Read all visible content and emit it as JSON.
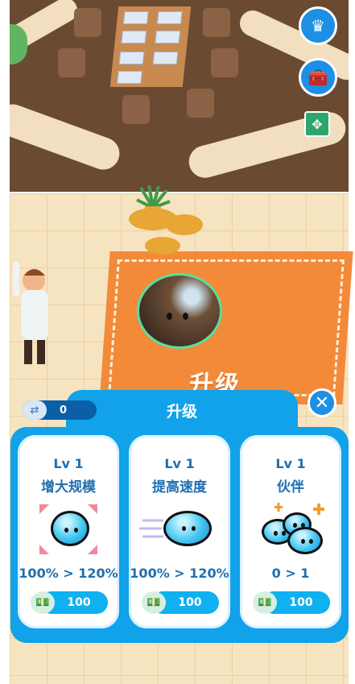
{
  "panel": {
    "title": "升级",
    "close_icon": "close-icon",
    "currency": {
      "icon": "slime-swap-icon",
      "value": "0"
    }
  },
  "scene": {
    "rug_label": "升级"
  },
  "hud": {
    "buttons": [
      "crown-icon",
      "toolbox-icon",
      "expand-icon"
    ]
  },
  "cards": [
    {
      "level": "Lv 1",
      "name": "增大规模",
      "stat": "100% > 120%",
      "price": "100",
      "art": "size-up-slime-icon"
    },
    {
      "level": "Lv 1",
      "name": "提高速度",
      "stat": "100% > 120%",
      "price": "100",
      "art": "speed-slime-icon"
    },
    {
      "level": "Lv 1",
      "name": "伙伴",
      "stat": "0 > 1",
      "price": "100",
      "art": "partner-slimes-icon"
    }
  ],
  "colors": {
    "panel": "#11a2ea",
    "button": "#0fb1f0",
    "text": "#1f6fb0"
  }
}
